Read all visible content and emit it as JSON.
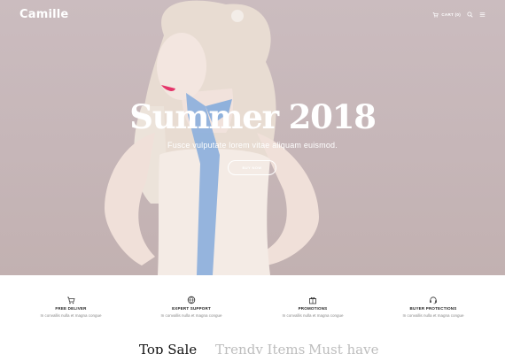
{
  "header": {
    "logo": "Camille",
    "cart_label": "CART (0)",
    "icons": [
      "cart-icon",
      "search-icon",
      "menu-icon"
    ]
  },
  "hero": {
    "title": "Summer 2018",
    "subtitle": "Fusce vulputate lorem vitae aliquam euismod.",
    "button_label": "BUY NOW"
  },
  "features": [
    {
      "icon": "cart-icon",
      "title": "FREE DELIVER",
      "desc": "In convallis nulla et magna congue"
    },
    {
      "icon": "globe-icon",
      "title": "EXPERT SUPPORT",
      "desc": "In convallis nulla et magna congue"
    },
    {
      "icon": "gift-icon",
      "title": "PROMOTIONS",
      "desc": "In convallis nulla et magna congue"
    },
    {
      "icon": "headset-icon",
      "title": "BUYER PROTECTIONS",
      "desc": "In convallis nulla et magna congue"
    }
  ],
  "tabs": [
    {
      "label": "Top Sale",
      "active": true
    },
    {
      "label": "Trendy Items",
      "active": false
    },
    {
      "label": "Must have",
      "active": false
    }
  ],
  "colors": {
    "hero_background": "#c6b6b8",
    "accent_text": "#ffffff",
    "muted_text": "#8a8a8a",
    "inactive_tab": "#bdbdbd"
  }
}
